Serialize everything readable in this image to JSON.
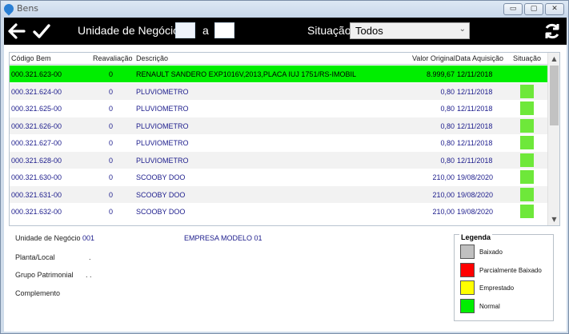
{
  "window": {
    "title": "Bens"
  },
  "window_controls": {
    "minimize": "▭",
    "maximize": "▢",
    "close": "✕"
  },
  "toolbar": {
    "back_icon": "back-arrow-icon",
    "confirm_icon": "check-icon",
    "refresh_icon": "refresh-icon",
    "unidade_label": "Unidade de Negócio",
    "unidade_from": "",
    "a_label": "a",
    "unidade_to": "",
    "situacao_label": "Situação",
    "situacao_value": "Todos"
  },
  "grid": {
    "headers": {
      "codigo": "Código Bem",
      "reavaliacao": "Reavaliação",
      "descricao": "Descrição",
      "valor": "Valor Original",
      "data": "Data Aquisição",
      "situacao": "Situação"
    },
    "rows": [
      {
        "codigo": "000.321.623-00",
        "reavaliacao": "0",
        "descricao": "RENAULT SANDERO EXP1016V,2013,PLACA IUJ 1751/RS-IMOBIL",
        "valor": "8.999,67",
        "data": "12/11/2018",
        "status": "Normal"
      },
      {
        "codigo": "000.321.624-00",
        "reavaliacao": "0",
        "descricao": "PLUVIOMETRO",
        "valor": "0,80",
        "data": "12/11/2018",
        "status": "Normal"
      },
      {
        "codigo": "000.321.625-00",
        "reavaliacao": "0",
        "descricao": "PLUVIOMETRO",
        "valor": "0,80",
        "data": "12/11/2018",
        "status": "Normal"
      },
      {
        "codigo": "000.321.626-00",
        "reavaliacao": "0",
        "descricao": "PLUVIOMETRO",
        "valor": "0,80",
        "data": "12/11/2018",
        "status": "Normal"
      },
      {
        "codigo": "000.321.627-00",
        "reavaliacao": "0",
        "descricao": "PLUVIOMETRO",
        "valor": "0,80",
        "data": "12/11/2018",
        "status": "Normal"
      },
      {
        "codigo": "000.321.628-00",
        "reavaliacao": "0",
        "descricao": "PLUVIOMETRO",
        "valor": "0,80",
        "data": "12/11/2018",
        "status": "Normal"
      },
      {
        "codigo": "000.321.630-00",
        "reavaliacao": "0",
        "descricao": "SCOOBY DOO",
        "valor": "210,00",
        "data": "19/08/2020",
        "status": "Normal"
      },
      {
        "codigo": "000.321.631-00",
        "reavaliacao": "0",
        "descricao": "SCOOBY DOO",
        "valor": "210,00",
        "data": "19/08/2020",
        "status": "Normal"
      },
      {
        "codigo": "000.321.632-00",
        "reavaliacao": "0",
        "descricao": "SCOOBY DOO",
        "valor": "210,00",
        "data": "19/08/2020",
        "status": "Normal"
      }
    ],
    "selected_index": 0
  },
  "details": {
    "unidade_label": "Unidade de Negócio",
    "unidade_code": "001",
    "unidade_name": "EMPRESA MODELO 01",
    "planta_label": "Planta/Local",
    "planta_value": ".",
    "grupo_label": "Grupo Patrimonial",
    "grupo_value": ". .",
    "complemento_label": "Complemento",
    "complemento_value": ""
  },
  "legend": {
    "title": "Legenda",
    "items": [
      {
        "label": "Baixado",
        "color": "#c0c0c0"
      },
      {
        "label": "Parcialmente Baixado",
        "color": "#ff0000"
      },
      {
        "label": "Emprestado",
        "color": "#ffff00"
      },
      {
        "label": "Normal",
        "color": "#00ee00"
      }
    ]
  },
  "colors": {
    "selected_row": "#00ee00",
    "status_normal": "#6ee83a",
    "toolbar_bg": "#000000",
    "link_text": "#1c1c8c"
  }
}
